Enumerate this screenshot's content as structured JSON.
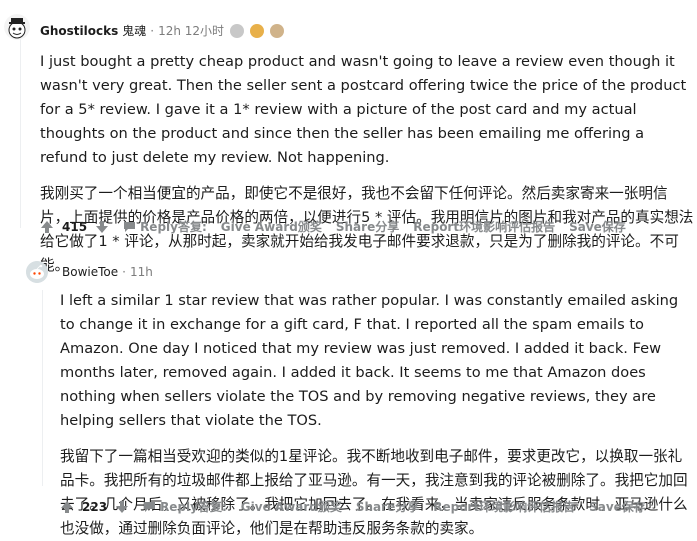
{
  "comments": [
    {
      "author": "Ghostilocks",
      "author_cjk": "鬼魂",
      "time": "12h 12小时",
      "body_en": "I just bought a pretty cheap product and wasn't going to leave a review even though it wasn't very great. Then the seller sent a postcard offering twice the price of the product for a 5* review. I gave it a 1* review with a picture of the post card and my actual thoughts on the product and since then the seller has been emailing me offering a refund to just delete my review. Not happening.",
      "body_cn": "我刚买了一个相当便宜的产品，即使它不是很好，我也不会留下任何评论。然后卖家寄来一张明信片，上面提供的价格是产品价格的两倍，以便进行5 * 评估。我用明信片的图片和我对产品的真实想法给它做了1 * 评论，从那时起，卖家就开始给我发电子邮件要求退款，只是为了删除我的评论。不可能。",
      "score": "415",
      "actions": [
        "Reply答复:",
        "Give Award颁奖",
        "Share分享",
        "Report环境影响评估报告",
        "Save保存"
      ]
    },
    {
      "author": "BowieToe",
      "time": "11h",
      "body_en": "I left a similar 1 star review that was rather popular. I was constantly emailed asking to change it in exchange for a gift card, F that. I reported all the spam emails to Amazon. One day I noticed that my review was just removed. I added it back. Few months later, removed again. I added it back. It seems to me that Amazon does nothing when sellers violate the TOS and by removing negative reviews, they are helping sellers that violate the TOS.",
      "body_cn": "我留下了一篇相当受欢迎的类似的1星评论。我不断地收到电子邮件，要求更改它，以换取一张礼品卡。我把所有的垃圾邮件都上报给了亚马逊。有一天，我注意到我的评论被删除了。我把它加回去了。几个月后，又被移除了。我把它加回去了。在我看来，当卖家违反服务条款时，亚马逊什么也没做，通过删除负面评论，他们是在帮助违反服务条款的卖家。",
      "score": "223",
      "actions": [
        "Reply答复:",
        "Give Award颁奖",
        "Share分享",
        "Report环境影响评估报告",
        "Save保存"
      ]
    }
  ],
  "colors": {
    "meta": "#7c7c7c",
    "action": "#878a8c",
    "text": "#1c1c1c",
    "thread": "#edeff1"
  },
  "icons": [
    "upvote-icon",
    "downvote-icon",
    "comment-icon",
    "award-icon"
  ]
}
